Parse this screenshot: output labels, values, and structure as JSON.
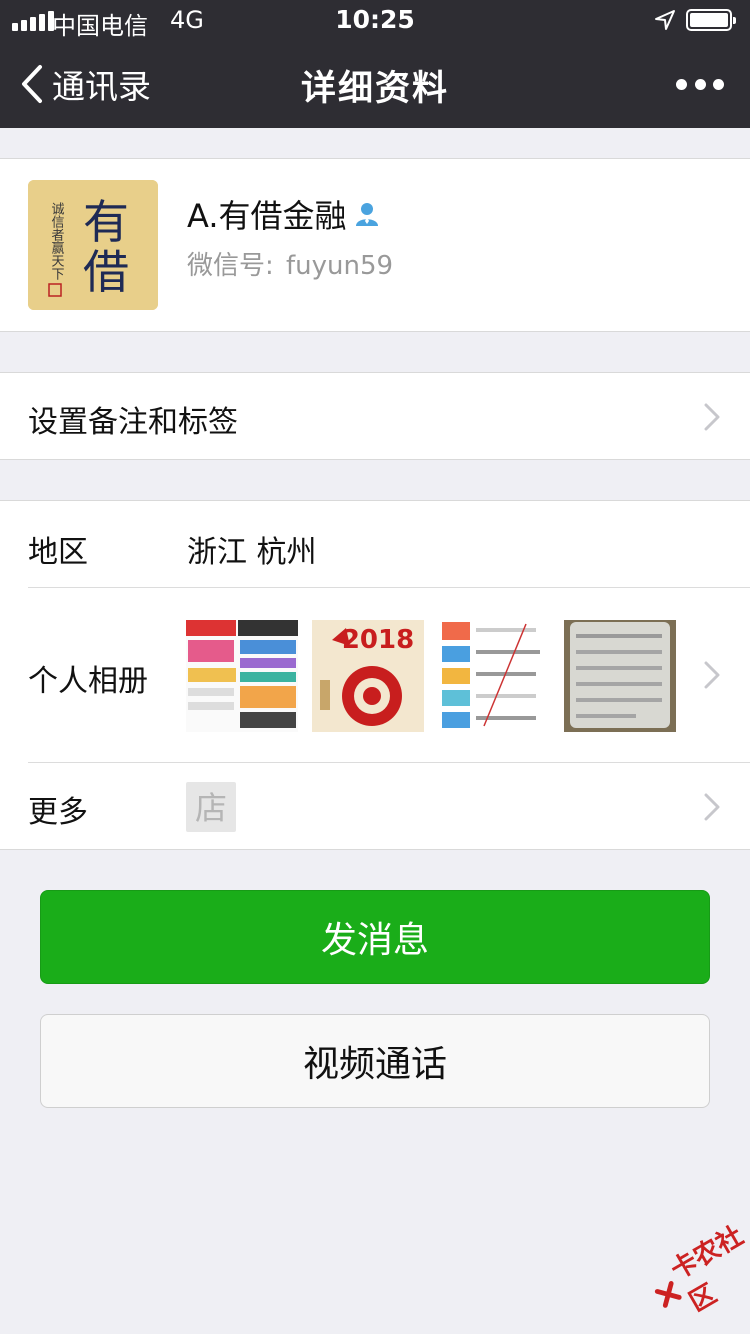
{
  "status_bar": {
    "carrier": "中国电信",
    "network": "4G",
    "time": "10:25"
  },
  "nav": {
    "back_label": "通讯录",
    "title": "详细资料",
    "more_icon": "more-dots-icon"
  },
  "profile": {
    "avatar_text": "有借",
    "avatar_side_text": "诚信者赢天下",
    "name": "A.有借金融",
    "wechat_id_label": "微信号:",
    "wechat_id_value": "fuyun59"
  },
  "remark_row": {
    "label": "设置备注和标签"
  },
  "info": {
    "region_label": "地区",
    "region_value": "浙江 杭州",
    "album_label": "个人相册",
    "album_thumbs": [
      "app-store-screenshot",
      "new-year-2018-card",
      "promo-list-screenshot",
      "phone-photo"
    ],
    "album_thumb2_text": "2018",
    "more_label": "更多",
    "shop_icon_text": "店"
  },
  "buttons": {
    "send_message": "发消息",
    "video_call": "视频通话"
  },
  "watermark": {
    "text": "卡农社区"
  },
  "colors": {
    "nav_bg": "#2e2d33",
    "page_bg": "#efeff4",
    "primary": "#1aad19"
  }
}
